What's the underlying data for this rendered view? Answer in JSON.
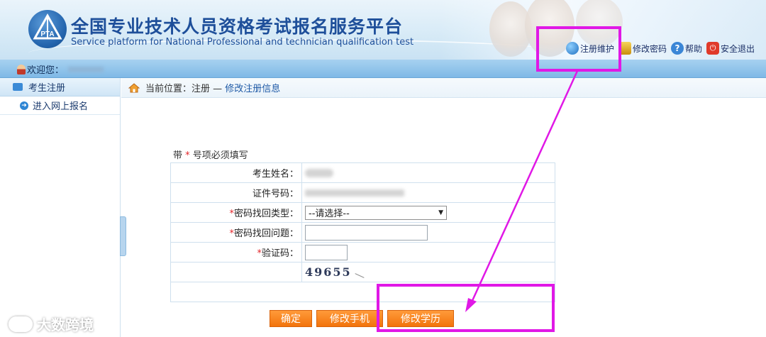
{
  "header": {
    "logo_text": "PTA",
    "title_cn": "全国专业技术人员资格考试报名服务平台",
    "title_en": "Service platform for National Professional and technician qualification test"
  },
  "toplinks": [
    {
      "label": "注册维护",
      "icon": "globe-icon",
      "color": "#2a78c8"
    },
    {
      "label": "修改密码",
      "icon": "lock-icon",
      "color": "#d7a20e"
    },
    {
      "label": "帮助",
      "icon": "help-icon",
      "color": "#2f7fd0"
    },
    {
      "label": "安全退出",
      "icon": "power-icon",
      "color": "#e03a2a"
    }
  ],
  "userbar": {
    "welcome": "欢迎您："
  },
  "sidebar": {
    "header": "考生注册",
    "items": [
      {
        "label": "进入网上报名"
      }
    ]
  },
  "breadcrumb": {
    "prefix": "当前位置：注册 — ",
    "current": "修改注册信息"
  },
  "form": {
    "required_note_pre": "带",
    "required_note_star": "*",
    "required_note_post": "号项必须填写",
    "rows": [
      {
        "label": "考生姓名：",
        "required": false
      },
      {
        "label": "证件号码：",
        "required": false
      },
      {
        "label": "密码找回类型：",
        "required": true
      },
      {
        "label": "密码找回问题：",
        "required": true
      },
      {
        "label": "验证码：",
        "required": true
      }
    ],
    "select_value": "--请选择--",
    "captcha": "49655"
  },
  "buttons": {
    "confirm": "确定",
    "change_phone": "修改手机",
    "change_education": "修改学历"
  },
  "watermark": "大数跨境",
  "colors": {
    "highlight": "#e018e6",
    "button": "#f2740c",
    "brand": "#1e4f9a"
  }
}
